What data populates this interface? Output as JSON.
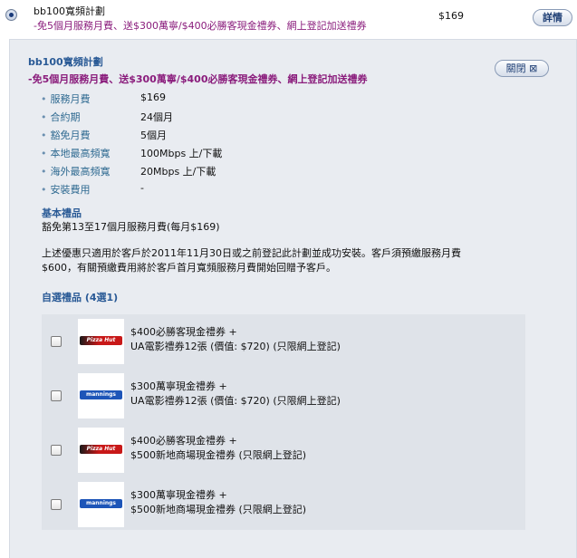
{
  "top": {
    "plan_name": "bb100寬頻計劃",
    "promo": "-免5個月服務月費、送$300萬寧/$400必勝客現金禮券、網上登記加送禮券",
    "price": "$169",
    "details_label": "詳情"
  },
  "panel": {
    "title": "bb100寬頻計劃",
    "promo": "-免5個月服務月費、送$300萬寧/$400必勝客現金禮券、網上登記加送禮券",
    "close_label": "關閉 ⊠",
    "specs": [
      {
        "label": "服務月費",
        "value": "$169"
      },
      {
        "label": "合約期",
        "value": "24個月"
      },
      {
        "label": "豁免月費",
        "value": "5個月"
      },
      {
        "label": "本地最高頻寬",
        "value": "100Mbps 上/下載"
      },
      {
        "label": "海外最高頻寬",
        "value": "20Mbps 上/下載"
      },
      {
        "label": "安裝費用",
        "value": "-"
      }
    ],
    "basic_gift_heading": "基本禮品",
    "basic_gift_text": "豁免第13至17個月服務月費(每月$169)",
    "notice_line1": "上述優惠只適用於客戶於2011年11月30日或之前登記此計劃並成功安裝。客戶須預繳服務月費",
    "notice_line2": "$600，有關預繳費用將於客戶首月寬頻服務月費開始回贈予客戶。",
    "optional_heading": "自選禮品 (4選1)",
    "options": [
      {
        "logo": "Pizza Hut",
        "line1": "$400必勝客現金禮券 +",
        "line2": "UA電影禮券12張 (價值: $720) (只限網上登記)",
        "checked": false
      },
      {
        "logo": "mannings",
        "line1": "$300萬寧現金禮券 +",
        "line2": "UA電影禮券12張 (價值: $720) (只限網上登記)",
        "checked": false
      },
      {
        "logo": "Pizza Hut",
        "line1": "$400必勝客現金禮券 +",
        "line2": "$500新地商場現金禮券 (只限網上登記)",
        "checked": false
      },
      {
        "logo": "mannings",
        "line1": "$300萬寧現金禮券 +",
        "line2": "$500新地商場現金禮券 (只限網上登記)",
        "checked": false
      }
    ]
  }
}
